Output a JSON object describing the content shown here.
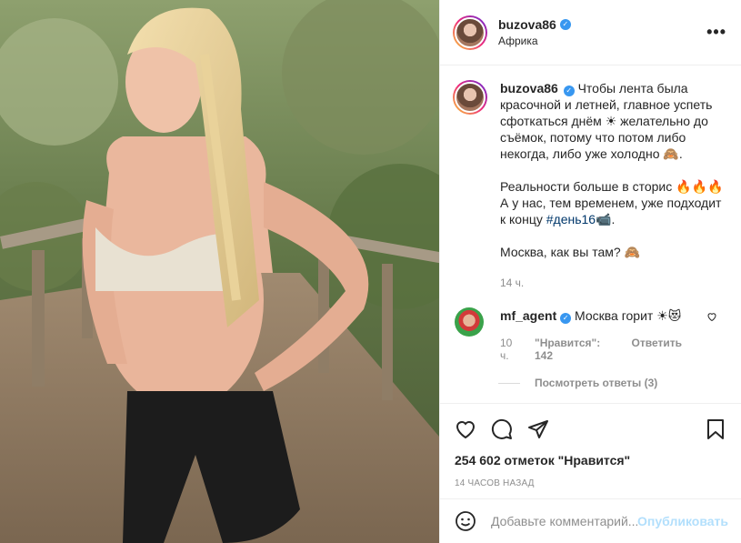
{
  "post": {
    "username": "buzova86",
    "location": "Африка",
    "more_label": "•••"
  },
  "caption": {
    "username": "buzova86",
    "para1": "Чтобы лента была красочной и летней, главное успеть сфоткаться днём ☀ желательно до съёмок, потому что потом либо некогда, либо уже холодно 🙈.",
    "para2_text": "Реальности больше в сторис 🔥🔥🔥 А у нас, тем временем, уже подходит к концу",
    "para2_hashtag": "#день16",
    "para2_emoji": "📹.",
    "para3": "Москва, как вы там? 🙈",
    "time": "14 ч."
  },
  "comment": {
    "username": "mf_agent",
    "text": "Москва горит ☀😻",
    "time": "10 ч.",
    "likes_label": "\"Нравится\": 142",
    "reply_label": "Ответить",
    "view_replies": "Посмотреть ответы (3)"
  },
  "stats": {
    "likes": "254 602 отметок \"Нравится\"",
    "ago": "14 часов назад"
  },
  "add_comment": {
    "placeholder": "Добавьте комментарий...",
    "post_label": "Опубликовать"
  },
  "icons": {
    "like": "heart-icon",
    "comment": "comment-icon",
    "share": "share-icon",
    "save": "bookmark-icon",
    "emoji": "emoji-icon"
  },
  "colors": {
    "accent": "#3897f0",
    "hashtag": "#00376b",
    "muted": "#8e8e8e"
  }
}
